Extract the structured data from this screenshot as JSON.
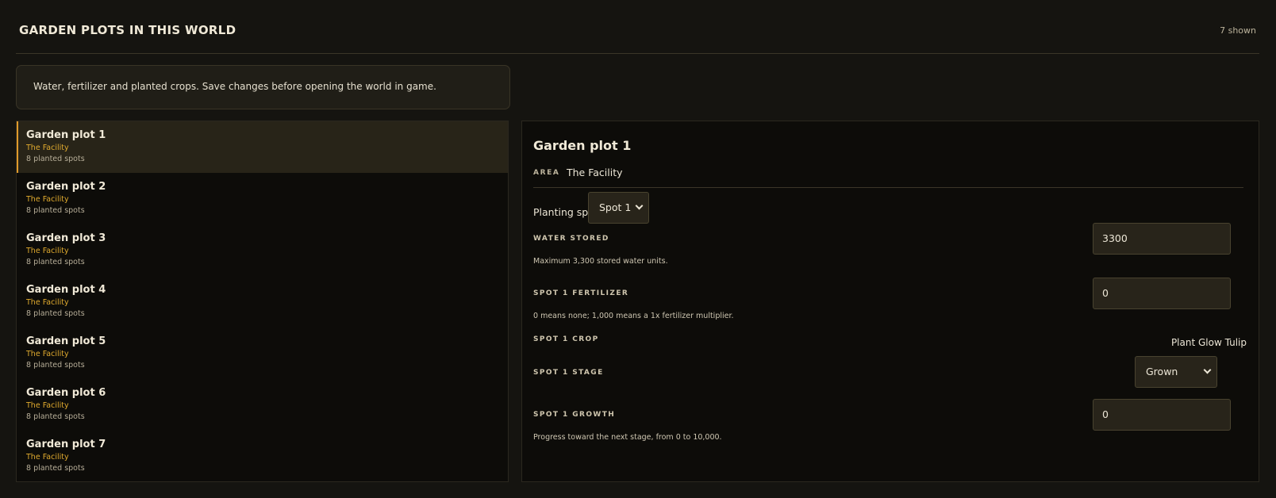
{
  "header": {
    "title": "GARDEN PLOTS IN THIS WORLD",
    "count": "7 shown"
  },
  "info": {
    "text": "Water, fertilizer and planted crops. Save changes before opening the world in game."
  },
  "plots": [
    {
      "name": "Garden plot 1",
      "area": "The Facility",
      "spots": "8 planted spots"
    },
    {
      "name": "Garden plot 2",
      "area": "The Facility",
      "spots": "8 planted spots"
    },
    {
      "name": "Garden plot 3",
      "area": "The Facility",
      "spots": "8 planted spots"
    },
    {
      "name": "Garden plot 4",
      "area": "The Facility",
      "spots": "8 planted spots"
    },
    {
      "name": "Garden plot 5",
      "area": "The Facility",
      "spots": "8 planted spots"
    },
    {
      "name": "Garden plot 6",
      "area": "The Facility",
      "spots": "8 planted spots"
    },
    {
      "name": "Garden plot 7",
      "area": "The Facility",
      "spots": "8 planted spots"
    }
  ],
  "selected_index": 0,
  "detail": {
    "title": "Garden plot 1",
    "area_label": "AREA",
    "area_value": "The Facility",
    "spot_label": "Planting spot",
    "spot_selected": "Spot 1",
    "water_label": "WATER STORED",
    "water_value": "3300",
    "water_hint": "Maximum 3,300 stored water units.",
    "fert_label": "SPOT 1 FERTILIZER",
    "fert_value": "0",
    "fert_hint": "0 means none; 1,000 means a 1x fertilizer multiplier.",
    "crop_label": "SPOT 1 CROP",
    "crop_value": "Plant Glow Tulip",
    "stage_label": "SPOT 1 STAGE",
    "stage_selected": "Grown",
    "growth_label": "SPOT 1 GROWTH",
    "growth_value": "0",
    "growth_hint": "Progress toward the next stage, from 0 to 10,000."
  },
  "colors": {
    "accent": "#e09a2b",
    "area_text": "#e0aa2e",
    "background": "#151410"
  }
}
